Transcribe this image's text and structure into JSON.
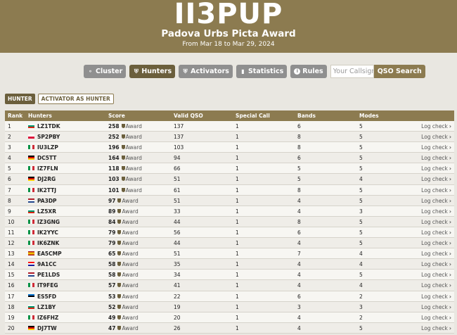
{
  "header": {
    "callsign": "II3PUP",
    "award_title": "Padova Urbs Picta Award",
    "dates": "From Mar 18 to Mar 29, 2024"
  },
  "nav": {
    "cluster": "Cluster",
    "hunters": "Hunters",
    "activators": "Activators",
    "statistics": "Statistics",
    "rules": "Rules",
    "callsign_placeholder": "Your Callsign",
    "qso_search": "QSO Search"
  },
  "tabs": {
    "hunter": "HUNTER",
    "activator_as_hunter": "ACTIVATOR AS HUNTER"
  },
  "table": {
    "headers": {
      "rank": "Rank",
      "hunters": "Hunters",
      "score": "Score",
      "valid_qso": "Valid QSO",
      "special_call": "Special Call",
      "bands": "Bands",
      "modes": "Modes"
    },
    "award_label": "Award",
    "log_check_label": "Log check",
    "rows": [
      {
        "rank": "1",
        "flag": "bg",
        "call": "LZ1TDK",
        "score": "258",
        "valid": "137",
        "special": "1",
        "bands": "6",
        "modes": "5"
      },
      {
        "rank": "2",
        "flag": "pl",
        "call": "SP2PBY",
        "score": "252",
        "valid": "137",
        "special": "1",
        "bands": "8",
        "modes": "5"
      },
      {
        "rank": "3",
        "flag": "it",
        "call": "IU3LZP",
        "score": "196",
        "valid": "103",
        "special": "1",
        "bands": "8",
        "modes": "5"
      },
      {
        "rank": "4",
        "flag": "de",
        "call": "DC5TT",
        "score": "164",
        "valid": "94",
        "special": "1",
        "bands": "6",
        "modes": "5"
      },
      {
        "rank": "5",
        "flag": "it",
        "call": "IZ7FLN",
        "score": "118",
        "valid": "66",
        "special": "1",
        "bands": "5",
        "modes": "5"
      },
      {
        "rank": "6",
        "flag": "de",
        "call": "DJ2RG",
        "score": "103",
        "valid": "51",
        "special": "1",
        "bands": "5",
        "modes": "4"
      },
      {
        "rank": "7",
        "flag": "it",
        "call": "IK2TTJ",
        "score": "101",
        "valid": "61",
        "special": "1",
        "bands": "8",
        "modes": "5"
      },
      {
        "rank": "8",
        "flag": "nl",
        "call": "PA3DP",
        "score": "97",
        "valid": "51",
        "special": "1",
        "bands": "4",
        "modes": "5"
      },
      {
        "rank": "9",
        "flag": "bg",
        "call": "LZ5XR",
        "score": "89",
        "valid": "33",
        "special": "1",
        "bands": "4",
        "modes": "3"
      },
      {
        "rank": "10",
        "flag": "it",
        "call": "IZ3GNG",
        "score": "84",
        "valid": "44",
        "special": "1",
        "bands": "8",
        "modes": "5"
      },
      {
        "rank": "11",
        "flag": "it",
        "call": "IK2YYC",
        "score": "79",
        "valid": "56",
        "special": "1",
        "bands": "6",
        "modes": "5"
      },
      {
        "rank": "12",
        "flag": "it",
        "call": "IK6ZNK",
        "score": "79",
        "valid": "44",
        "special": "1",
        "bands": "4",
        "modes": "5"
      },
      {
        "rank": "13",
        "flag": "es",
        "call": "EA5CMP",
        "score": "65",
        "valid": "51",
        "special": "1",
        "bands": "7",
        "modes": "4"
      },
      {
        "rank": "14",
        "flag": "hr",
        "call": "9A1CC",
        "score": "58",
        "valid": "35",
        "special": "1",
        "bands": "4",
        "modes": "4"
      },
      {
        "rank": "15",
        "flag": "nl",
        "call": "PE1LDS",
        "score": "58",
        "valid": "34",
        "special": "1",
        "bands": "4",
        "modes": "5"
      },
      {
        "rank": "16",
        "flag": "it",
        "call": "IT9FEG",
        "score": "57",
        "valid": "41",
        "special": "1",
        "bands": "4",
        "modes": "4"
      },
      {
        "rank": "17",
        "flag": "ee",
        "call": "ES5FD",
        "score": "53",
        "valid": "22",
        "special": "1",
        "bands": "6",
        "modes": "2"
      },
      {
        "rank": "18",
        "flag": "bg",
        "call": "LZ1BY",
        "score": "52",
        "valid": "19",
        "special": "1",
        "bands": "3",
        "modes": "3"
      },
      {
        "rank": "19",
        "flag": "it",
        "call": "IZ6FHZ",
        "score": "49",
        "valid": "20",
        "special": "1",
        "bands": "4",
        "modes": "2"
      },
      {
        "rank": "20",
        "flag": "de",
        "call": "DJ7TW",
        "score": "47",
        "valid": "26",
        "special": "1",
        "bands": "4",
        "modes": "5"
      }
    ]
  }
}
